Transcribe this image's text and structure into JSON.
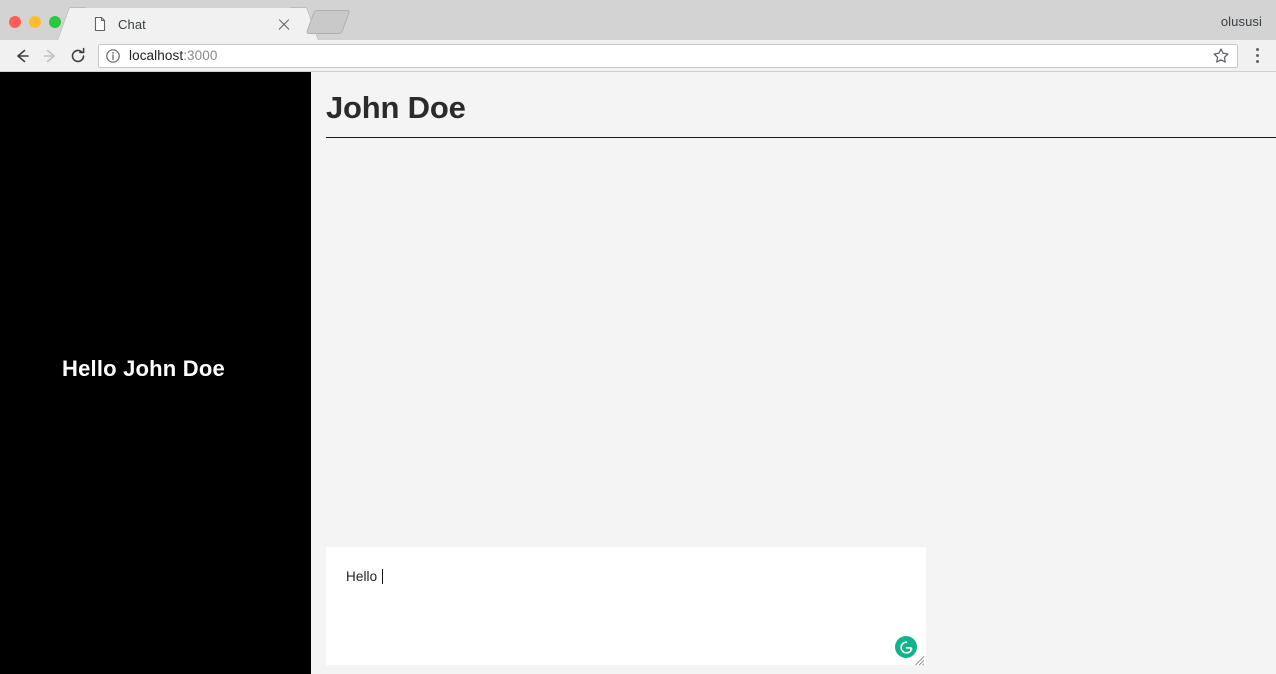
{
  "browser": {
    "window_controls": [
      {
        "name": "close",
        "color": "#ff5f57"
      },
      {
        "name": "minimize",
        "color": "#febc2e"
      },
      {
        "name": "maximize",
        "color": "#28c840"
      }
    ],
    "tab": {
      "title": "Chat",
      "favicon_icon": "page-icon",
      "close_icon": "close-icon"
    },
    "new_tab_label": "",
    "profile_name": "olususi",
    "toolbar": {
      "back_icon": "arrow-left-icon",
      "forward_icon": "arrow-right-icon",
      "reload_icon": "reload-icon",
      "security_icon": "info-circle-icon",
      "url_host": "localhost",
      "url_port": ":3000",
      "bookmark_icon": "star-icon",
      "menu_icon": "three-dot-menu-icon"
    }
  },
  "page": {
    "sidebar": {
      "greeting": "Hello John Doe",
      "background": "#000000"
    },
    "main": {
      "title": "John Doe",
      "messages": [],
      "composer": {
        "value": "Hello ",
        "placeholder": "",
        "grammarly_icon": "grammarly-logo-icon",
        "grammarly_color": "#11b48a",
        "resize_icon": "resize-grip-icon"
      }
    }
  }
}
